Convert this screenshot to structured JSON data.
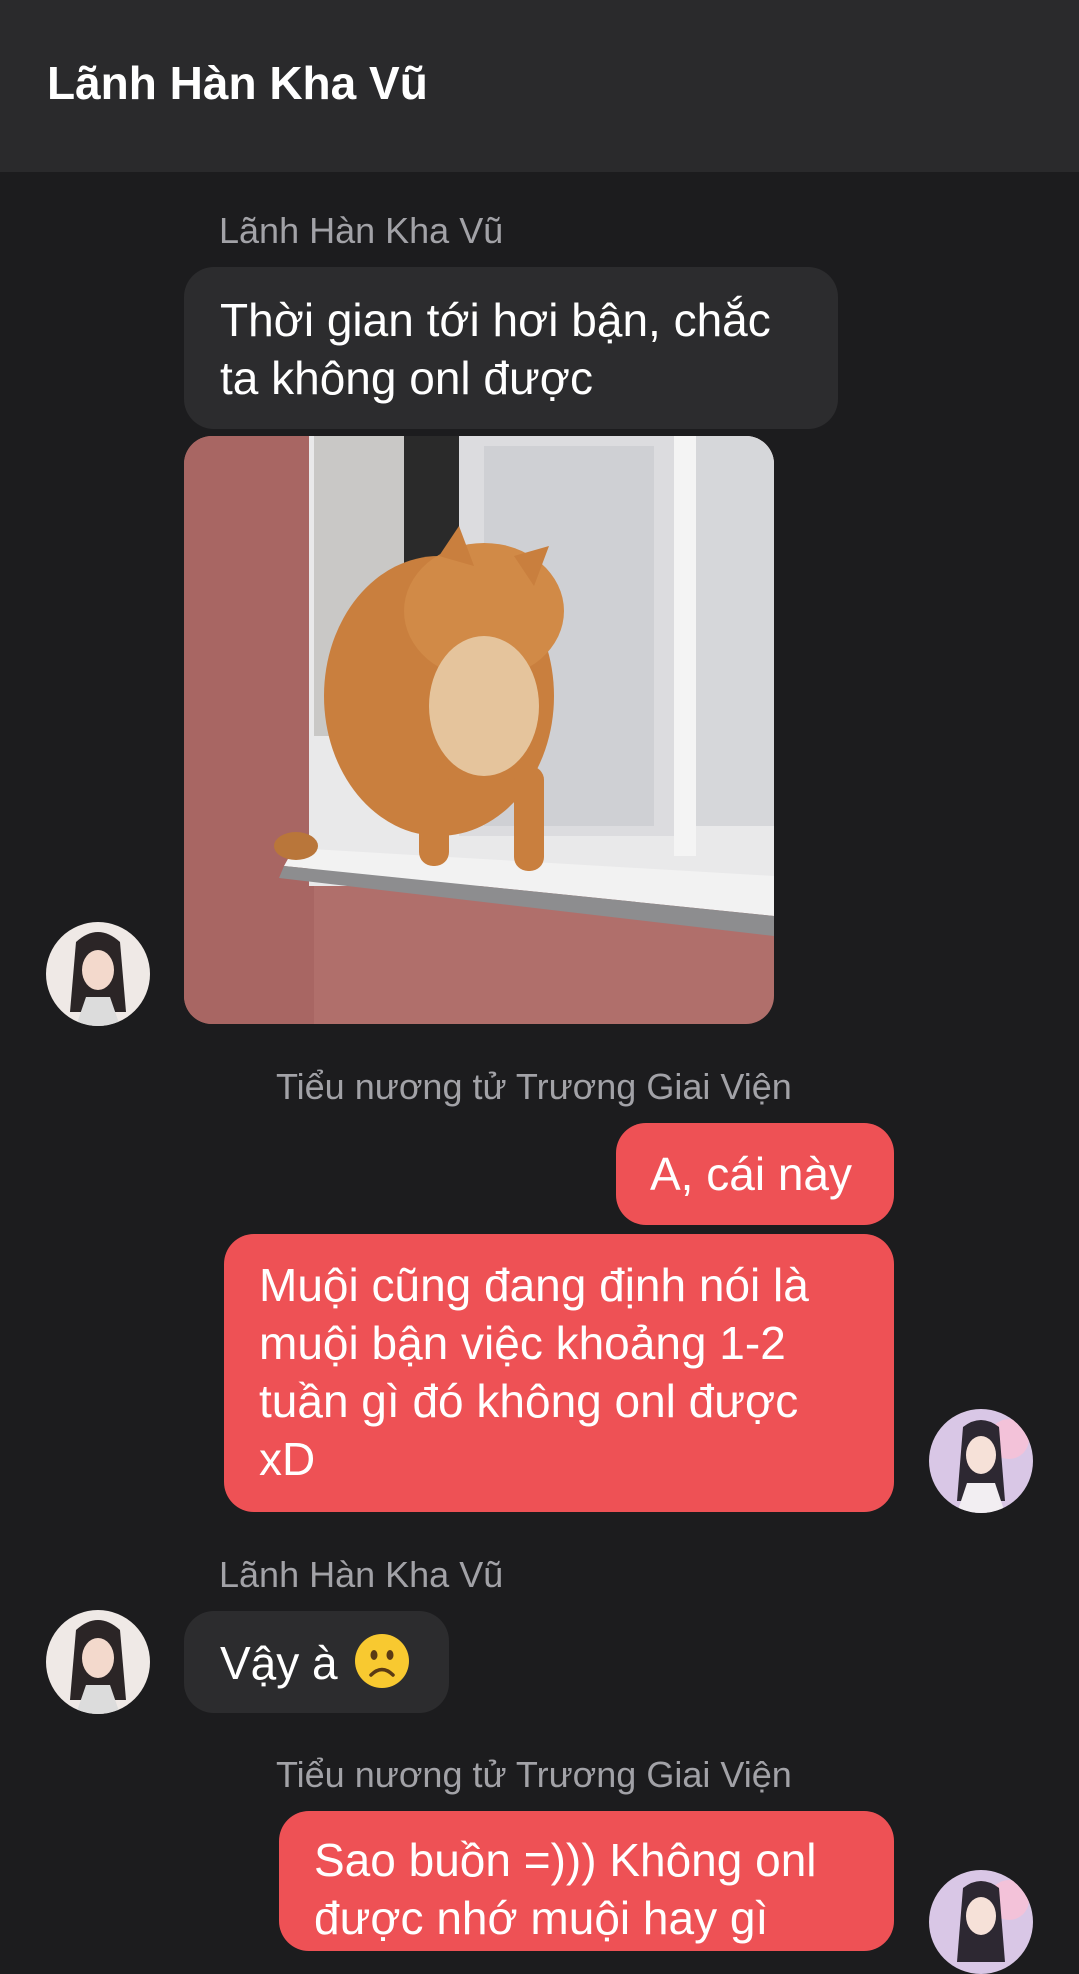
{
  "header": {
    "title": "Lãnh Hàn Kha Vũ"
  },
  "messages": [
    {
      "sender": "Lãnh Hàn Kha Vũ",
      "text": "Thời gian tới hơi bận, chắc ta không onl được",
      "line1": "Thời gian tới hơi bận, chắc",
      "line2": "ta không onl được"
    },
    {
      "sender": "Tiểu nương tử Trương Giai Viện",
      "text1": "A, cái này",
      "text2_lines": [
        "Muội cũng đang định nói là",
        "muội bận việc khoảng 1-2",
        "tuần gì đó không onl được",
        "xD"
      ]
    },
    {
      "sender": "Lãnh Hàn Kha Vũ",
      "text": "Vậy à",
      "emoji": "frowning-face"
    },
    {
      "sender": "Tiểu nương tử Trương Giai Viện",
      "line1": "Sao buồn =))) Không onl",
      "line2": "được nhớ muội hay gì"
    }
  ],
  "colors": {
    "incoming": "#2c2c2e",
    "outgoing": "#ee5155",
    "background": "#1c1c1e",
    "header": "#2a2a2c"
  }
}
